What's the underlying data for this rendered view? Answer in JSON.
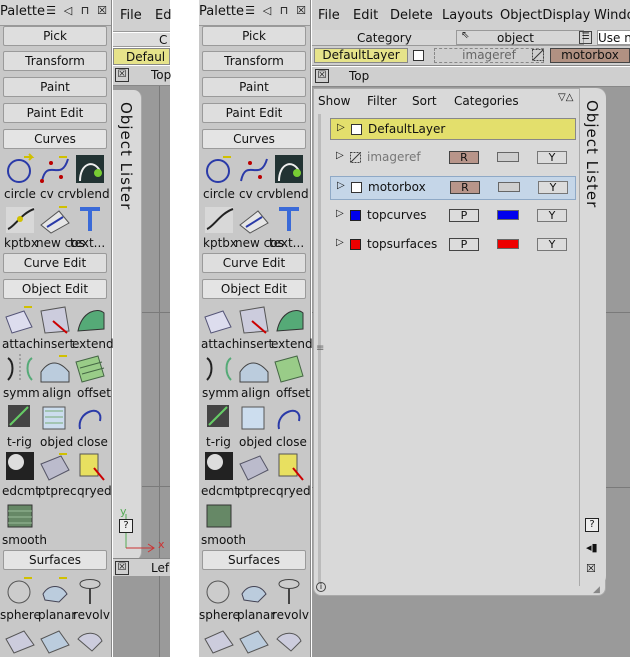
{
  "palette": {
    "title": "Palette",
    "buttons": [
      "Pick",
      "Transform",
      "Paint",
      "Paint Edit"
    ],
    "curves_header": "Curves",
    "curves_tools": [
      "circle",
      "cv crv",
      "blend",
      "kptbx",
      "new cos",
      "text..."
    ],
    "curve_edit": "Curve Edit",
    "object_edit": "Object Edit",
    "object_tools": [
      "attach",
      "insert",
      "extend",
      "symm",
      "align",
      "offset",
      "t-rig",
      "objed",
      "close",
      "edcmt",
      "ptprec",
      "qryed",
      "smooth"
    ],
    "surfaces": "Surfaces",
    "surface_tools": [
      "sphere",
      "planar",
      "revolv"
    ]
  },
  "left_app": {
    "menus": [
      "File",
      "Ed"
    ],
    "category_partial": "C",
    "layer_partial": "Defaul",
    "viewport_top": "Top",
    "viewport_left": "Lef",
    "lister_vertical": "Object Lister",
    "axis_x": "x",
    "axis_y": "y",
    "help": "?"
  },
  "right_app": {
    "menus": [
      "File",
      "Edit",
      "Delete",
      "Layouts",
      "ObjectDisplay",
      "Windo"
    ],
    "toolbar": {
      "category": "Category",
      "object": "object",
      "use": "Use n",
      "default_layer": "DefaultLayer",
      "imageref": "imageref",
      "motorbox": "motorbox"
    },
    "viewport_top": "Top",
    "lister": {
      "title": "Object Lister",
      "tabs": [
        "Show",
        "Filter",
        "Sort",
        "Categories"
      ],
      "rows": [
        {
          "name": "DefaultLayer",
          "state": "",
          "sel": "",
          "color": "",
          "y": ""
        },
        {
          "name": "imageref",
          "state": "R",
          "sel": "",
          "color": "#cfcfcf",
          "y": "Y"
        },
        {
          "name": "motorbox",
          "state": "R",
          "sel": "",
          "color": "#cfcfcf",
          "y": "Y"
        },
        {
          "name": "topcurves",
          "state": "P",
          "sel": "",
          "color": "#0000ee",
          "y": "Y"
        },
        {
          "name": "topsurfaces",
          "state": "P",
          "sel": "",
          "color": "#ee0000",
          "y": "Y"
        }
      ],
      "help": "?"
    }
  }
}
